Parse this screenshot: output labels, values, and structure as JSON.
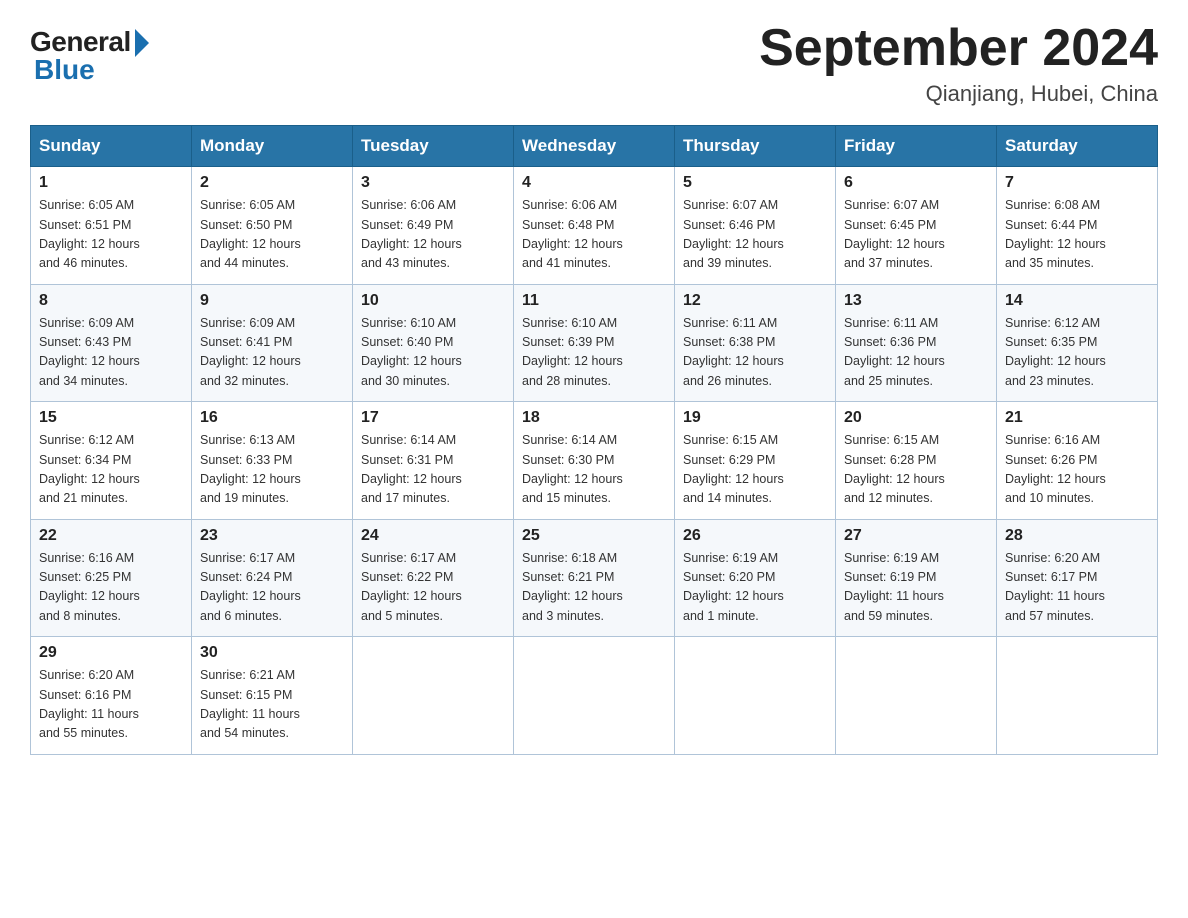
{
  "logo": {
    "general": "General",
    "blue": "Blue"
  },
  "title": "September 2024",
  "location": "Qianjiang, Hubei, China",
  "days_of_week": [
    "Sunday",
    "Monday",
    "Tuesday",
    "Wednesday",
    "Thursday",
    "Friday",
    "Saturday"
  ],
  "weeks": [
    [
      {
        "day": "1",
        "sunrise": "6:05 AM",
        "sunset": "6:51 PM",
        "daylight": "12 hours and 46 minutes."
      },
      {
        "day": "2",
        "sunrise": "6:05 AM",
        "sunset": "6:50 PM",
        "daylight": "12 hours and 44 minutes."
      },
      {
        "day": "3",
        "sunrise": "6:06 AM",
        "sunset": "6:49 PM",
        "daylight": "12 hours and 43 minutes."
      },
      {
        "day": "4",
        "sunrise": "6:06 AM",
        "sunset": "6:48 PM",
        "daylight": "12 hours and 41 minutes."
      },
      {
        "day": "5",
        "sunrise": "6:07 AM",
        "sunset": "6:46 PM",
        "daylight": "12 hours and 39 minutes."
      },
      {
        "day": "6",
        "sunrise": "6:07 AM",
        "sunset": "6:45 PM",
        "daylight": "12 hours and 37 minutes."
      },
      {
        "day": "7",
        "sunrise": "6:08 AM",
        "sunset": "6:44 PM",
        "daylight": "12 hours and 35 minutes."
      }
    ],
    [
      {
        "day": "8",
        "sunrise": "6:09 AM",
        "sunset": "6:43 PM",
        "daylight": "12 hours and 34 minutes."
      },
      {
        "day": "9",
        "sunrise": "6:09 AM",
        "sunset": "6:41 PM",
        "daylight": "12 hours and 32 minutes."
      },
      {
        "day": "10",
        "sunrise": "6:10 AM",
        "sunset": "6:40 PM",
        "daylight": "12 hours and 30 minutes."
      },
      {
        "day": "11",
        "sunrise": "6:10 AM",
        "sunset": "6:39 PM",
        "daylight": "12 hours and 28 minutes."
      },
      {
        "day": "12",
        "sunrise": "6:11 AM",
        "sunset": "6:38 PM",
        "daylight": "12 hours and 26 minutes."
      },
      {
        "day": "13",
        "sunrise": "6:11 AM",
        "sunset": "6:36 PM",
        "daylight": "12 hours and 25 minutes."
      },
      {
        "day": "14",
        "sunrise": "6:12 AM",
        "sunset": "6:35 PM",
        "daylight": "12 hours and 23 minutes."
      }
    ],
    [
      {
        "day": "15",
        "sunrise": "6:12 AM",
        "sunset": "6:34 PM",
        "daylight": "12 hours and 21 minutes."
      },
      {
        "day": "16",
        "sunrise": "6:13 AM",
        "sunset": "6:33 PM",
        "daylight": "12 hours and 19 minutes."
      },
      {
        "day": "17",
        "sunrise": "6:14 AM",
        "sunset": "6:31 PM",
        "daylight": "12 hours and 17 minutes."
      },
      {
        "day": "18",
        "sunrise": "6:14 AM",
        "sunset": "6:30 PM",
        "daylight": "12 hours and 15 minutes."
      },
      {
        "day": "19",
        "sunrise": "6:15 AM",
        "sunset": "6:29 PM",
        "daylight": "12 hours and 14 minutes."
      },
      {
        "day": "20",
        "sunrise": "6:15 AM",
        "sunset": "6:28 PM",
        "daylight": "12 hours and 12 minutes."
      },
      {
        "day": "21",
        "sunrise": "6:16 AM",
        "sunset": "6:26 PM",
        "daylight": "12 hours and 10 minutes."
      }
    ],
    [
      {
        "day": "22",
        "sunrise": "6:16 AM",
        "sunset": "6:25 PM",
        "daylight": "12 hours and 8 minutes."
      },
      {
        "day": "23",
        "sunrise": "6:17 AM",
        "sunset": "6:24 PM",
        "daylight": "12 hours and 6 minutes."
      },
      {
        "day": "24",
        "sunrise": "6:17 AM",
        "sunset": "6:22 PM",
        "daylight": "12 hours and 5 minutes."
      },
      {
        "day": "25",
        "sunrise": "6:18 AM",
        "sunset": "6:21 PM",
        "daylight": "12 hours and 3 minutes."
      },
      {
        "day": "26",
        "sunrise": "6:19 AM",
        "sunset": "6:20 PM",
        "daylight": "12 hours and 1 minute."
      },
      {
        "day": "27",
        "sunrise": "6:19 AM",
        "sunset": "6:19 PM",
        "daylight": "11 hours and 59 minutes."
      },
      {
        "day": "28",
        "sunrise": "6:20 AM",
        "sunset": "6:17 PM",
        "daylight": "11 hours and 57 minutes."
      }
    ],
    [
      {
        "day": "29",
        "sunrise": "6:20 AM",
        "sunset": "6:16 PM",
        "daylight": "11 hours and 55 minutes."
      },
      {
        "day": "30",
        "sunrise": "6:21 AM",
        "sunset": "6:15 PM",
        "daylight": "11 hours and 54 minutes."
      },
      null,
      null,
      null,
      null,
      null
    ]
  ],
  "labels": {
    "sunrise": "Sunrise:",
    "sunset": "Sunset:",
    "daylight": "Daylight:"
  }
}
